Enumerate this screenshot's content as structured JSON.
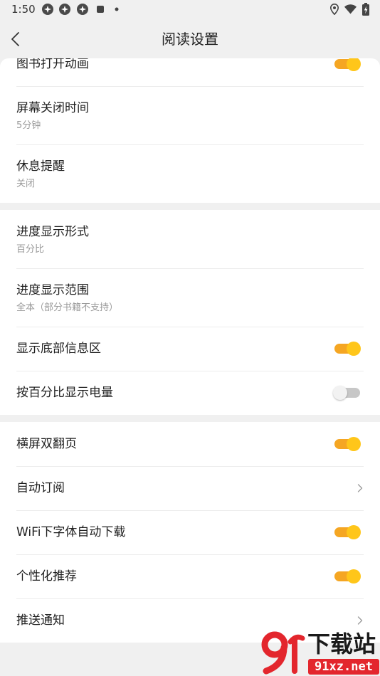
{
  "status_bar": {
    "time": "1:50",
    "left_icons": [
      "app-notification-icon",
      "app-notification-icon",
      "app-notification-icon",
      "stop-square-icon",
      "more-dot-icon"
    ],
    "right_icons": [
      "location-icon",
      "wifi-icon",
      "battery-charging-icon"
    ]
  },
  "header": {
    "title": "阅读设置",
    "back_icon": "chevron-left-icon"
  },
  "sections": [
    {
      "rows": [
        {
          "title": "图书打开动画",
          "toggle_on": true
        },
        {
          "title": "屏幕关闭时间",
          "subtitle": "5分钟"
        },
        {
          "title": "休息提醒",
          "subtitle": "关闭"
        }
      ]
    },
    {
      "rows": [
        {
          "title": "进度显示形式",
          "subtitle": "百分比"
        },
        {
          "title": "进度显示范围",
          "subtitle": "全本（部分书籍不支持）"
        },
        {
          "title": "显示底部信息区",
          "toggle_on": true
        },
        {
          "title": "按百分比显示电量",
          "toggle_on": false
        }
      ]
    },
    {
      "rows": [
        {
          "title": "横屏双翻页",
          "toggle_on": true
        },
        {
          "title": "自动订阅",
          "chevron_icon": "chevron-right-icon"
        },
        {
          "title": "WiFi下字体自动下载",
          "toggle_on": true
        },
        {
          "title": "个性化推荐",
          "toggle_on": true
        },
        {
          "title": "推送通知",
          "chevron_icon": "chevron-right-icon"
        }
      ]
    }
  ],
  "colors": {
    "background": "#f0f0f0",
    "card": "#ffffff",
    "toggle_on_track": "#f5a623",
    "toggle_on_knob": "#ffc61a",
    "toggle_off_track": "#c7c7c7",
    "toggle_off_knob": "#f2f2f2",
    "watermark_red": "#e3262d"
  },
  "watermark": {
    "logo_mark": "91",
    "name": "下载站",
    "url": "91xz.net"
  }
}
